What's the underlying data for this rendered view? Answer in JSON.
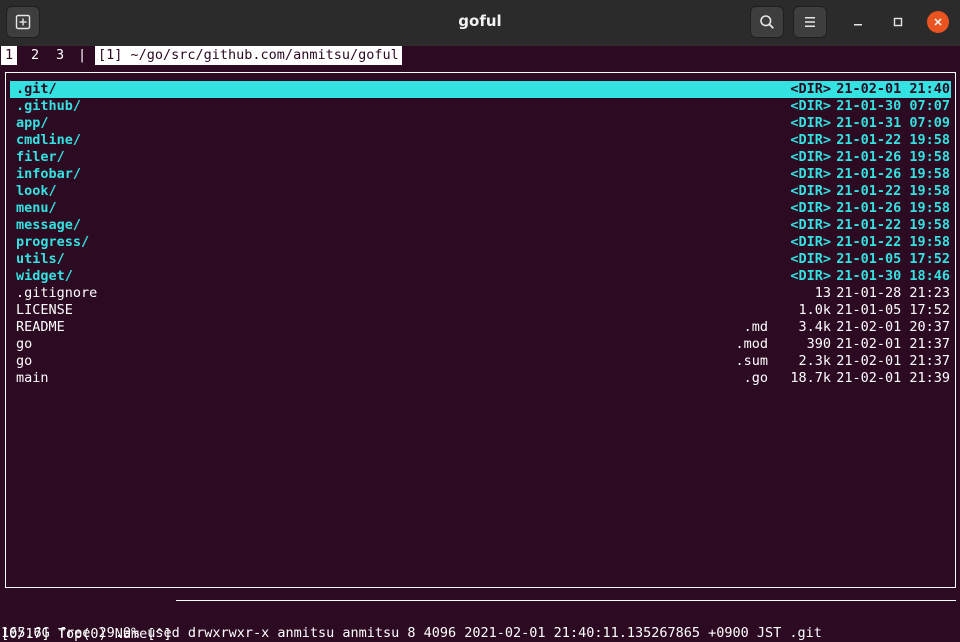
{
  "window": {
    "title": "goful",
    "new_tab_icon": "new-tab-icon",
    "search_icon": "search-icon",
    "menu_icon": "hamburger-menu-icon"
  },
  "tabs": [
    {
      "label": "1",
      "active": true
    },
    {
      "label": "2",
      "active": false
    },
    {
      "label": "3",
      "active": false
    }
  ],
  "tab_separator": "|",
  "path": "[1] ~/go/src/github.com/anmitsu/goful",
  "files": [
    {
      "name": ".git/",
      "ext": "",
      "size": "<DIR>",
      "date": "21-02-01 21:40",
      "dir": true
    },
    {
      "name": ".github/",
      "ext": "",
      "size": "<DIR>",
      "date": "21-01-30 07:07",
      "dir": true
    },
    {
      "name": "app/",
      "ext": "",
      "size": "<DIR>",
      "date": "21-01-31 07:09",
      "dir": true
    },
    {
      "name": "cmdline/",
      "ext": "",
      "size": "<DIR>",
      "date": "21-01-22 19:58",
      "dir": true
    },
    {
      "name": "filer/",
      "ext": "",
      "size": "<DIR>",
      "date": "21-01-26 19:58",
      "dir": true
    },
    {
      "name": "infobar/",
      "ext": "",
      "size": "<DIR>",
      "date": "21-01-26 19:58",
      "dir": true
    },
    {
      "name": "look/",
      "ext": "",
      "size": "<DIR>",
      "date": "21-01-22 19:58",
      "dir": true
    },
    {
      "name": "menu/",
      "ext": "",
      "size": "<DIR>",
      "date": "21-01-26 19:58",
      "dir": true
    },
    {
      "name": "message/",
      "ext": "",
      "size": "<DIR>",
      "date": "21-01-22 19:58",
      "dir": true
    },
    {
      "name": "progress/",
      "ext": "",
      "size": "<DIR>",
      "date": "21-01-22 19:58",
      "dir": true
    },
    {
      "name": "utils/",
      "ext": "",
      "size": "<DIR>",
      "date": "21-01-05 17:52",
      "dir": true
    },
    {
      "name": "widget/",
      "ext": "",
      "size": "<DIR>",
      "date": "21-01-30 18:46",
      "dir": true
    },
    {
      "name": ".gitignore",
      "ext": "",
      "size": "13",
      "date": "21-01-28 21:23",
      "dir": false
    },
    {
      "name": "LICENSE",
      "ext": "",
      "size": "1.0k",
      "date": "21-01-05 17:52",
      "dir": false
    },
    {
      "name": "README",
      "ext": ".md",
      "size": "3.4k",
      "date": "21-02-01 20:37",
      "dir": false
    },
    {
      "name": "go",
      "ext": ".mod",
      "size": "390",
      "date": "21-02-01 21:37",
      "dir": false
    },
    {
      "name": "go",
      "ext": ".sum",
      "size": "2.3k",
      "date": "21-02-01 21:37",
      "dir": false
    },
    {
      "name": "main",
      "ext": ".go",
      "size": "18.7k",
      "date": "21-02-01 21:39",
      "dir": false
    }
  ],
  "cursor_index": 0,
  "panel_status": "[0/17] Top(0) Name[^]",
  "infobar": "165.6G free 29.0% used drwxrwxr-x anmitsu anmitsu 8 4096 2021-02-01 21:40:11.135267865 +0900 JST .git",
  "colors": {
    "background": "#2c0a22",
    "directory": "#34e2e2",
    "close_button": "#e95420"
  }
}
